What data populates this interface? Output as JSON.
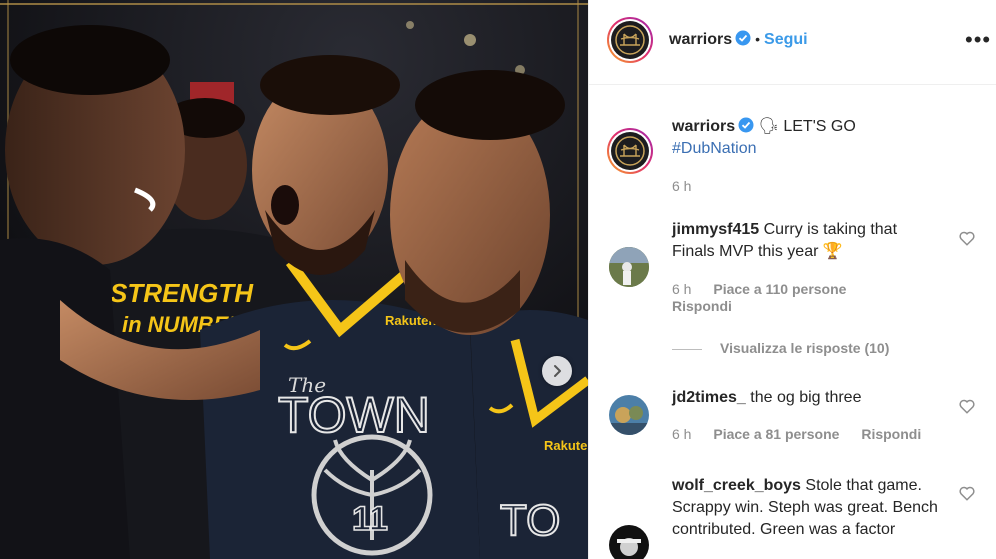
{
  "post": {
    "username": "warriors",
    "follow_label": "Segui",
    "separator": "•",
    "more_label": "•••"
  },
  "caption": {
    "username": "warriors",
    "emoji": "🗣",
    "text": "LET'S GO",
    "hashtag": "#DubNation",
    "time": "6 h"
  },
  "comments": [
    {
      "username": "jimmysf415",
      "text": "Curry is taking that Finals MVP this year 🏆",
      "time": "6 h",
      "likes": "Piace a 110 persone",
      "reply": "Rispondi",
      "view_replies": "Visualizza le risposte (10)"
    },
    {
      "username": "jd2times_",
      "text": "the og big three",
      "time": "6 h",
      "likes": "Piace a 81 persone",
      "reply": "Rispondi"
    },
    {
      "username": "wolf_creek_boys",
      "text": "Stole that game. Scrappy win. Steph was great. Bench contributed. Green was a factor"
    }
  ],
  "photo": {
    "shirt_text_1": "STRENGTH",
    "shirt_text_2": "in NUMBERS",
    "jersey_text": "TOWN",
    "jersey_prefix": "The",
    "jersey_number": "11",
    "sponsor": "Rakuten"
  },
  "colors": {
    "accent_blue": "#3b9ae8",
    "warriors_gold": "#f5c518",
    "warriors_navy": "#1b2436"
  }
}
